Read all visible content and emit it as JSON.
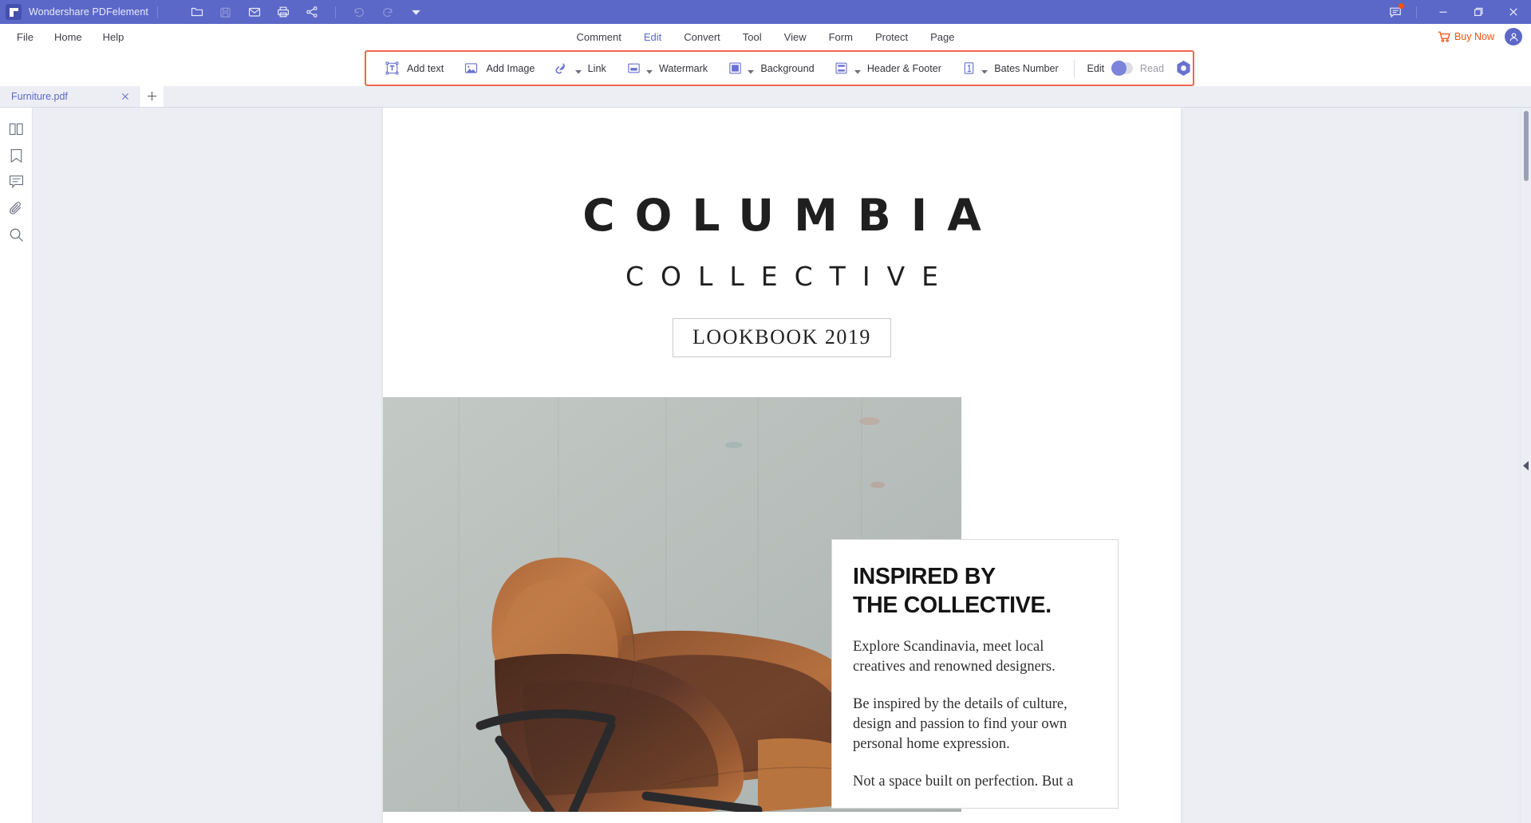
{
  "app": {
    "title": "Wondershare PDFelement",
    "accent": "#5b68c8",
    "highlight_box_color": "#ef6653",
    "buy_color": "#f4500f"
  },
  "titlebar": {
    "quick_actions": [
      {
        "name": "open-folder-icon",
        "label": "Open"
      },
      {
        "name": "save-icon",
        "label": "Save"
      },
      {
        "name": "email-icon",
        "label": "Email"
      },
      {
        "name": "print-icon",
        "label": "Print"
      },
      {
        "name": "share-icon",
        "label": "Share"
      },
      {
        "name": "undo-icon",
        "label": "Undo"
      },
      {
        "name": "redo-icon",
        "label": "Redo"
      },
      {
        "name": "customize-icon",
        "label": "Customize Quick Access Toolbar"
      }
    ],
    "notification_label": "Notifications",
    "window_controls": {
      "minimize": "Minimize",
      "maximize": "Restore",
      "close": "Close"
    }
  },
  "menubar": {
    "left_items": [
      {
        "label": "File",
        "active": false
      },
      {
        "label": "Home",
        "active": false
      },
      {
        "label": "Help",
        "active": false
      }
    ],
    "center_items": [
      {
        "label": "Comment",
        "active": false
      },
      {
        "label": "Edit",
        "active": true
      },
      {
        "label": "Convert",
        "active": false
      },
      {
        "label": "Tool",
        "active": false
      },
      {
        "label": "View",
        "active": false
      },
      {
        "label": "Form",
        "active": false
      },
      {
        "label": "Protect",
        "active": false
      },
      {
        "label": "Page",
        "active": false
      }
    ],
    "buy_now_label": "Buy Now",
    "account_label": "Account"
  },
  "ribbon": {
    "items": [
      {
        "label": "Add text",
        "icon": "add-text-icon",
        "caret": false
      },
      {
        "label": "Add Image",
        "icon": "add-image-icon",
        "caret": false
      },
      {
        "label": "Link",
        "icon": "link-icon",
        "caret": true
      },
      {
        "label": "Watermark",
        "icon": "watermark-icon",
        "caret": true
      },
      {
        "label": "Background",
        "icon": "background-icon",
        "caret": true
      },
      {
        "label": "Header & Footer",
        "icon": "header-footer-icon",
        "caret": true
      },
      {
        "label": "Bates Number",
        "icon": "bates-number-icon",
        "caret": true
      }
    ],
    "mode_toggle": {
      "on_label": "Edit",
      "off_label": "Read",
      "state": "Edit"
    },
    "extra_button": "advanced-mode-icon"
  },
  "tabstrip": {
    "tabs": [
      {
        "name": "Furniture.pdf",
        "active": true
      }
    ],
    "close_label": "Close tab",
    "new_tab_label": "New tab"
  },
  "leftrail": {
    "items": [
      {
        "name": "thumbnails-icon",
        "label": "Thumbnails"
      },
      {
        "name": "bookmark-icon",
        "label": "Bookmarks"
      },
      {
        "name": "comment-icon",
        "label": "Annotations"
      },
      {
        "name": "attachment-icon",
        "label": "Attachments"
      },
      {
        "name": "search-icon",
        "label": "Search"
      }
    ],
    "expand_label": "Expand panel"
  },
  "document": {
    "brand_line1": "COLUMBIA",
    "brand_line2": "COLLECTIVE",
    "badge": "LOOKBOOK 2019",
    "photo_alt": "Tan leather armchair against a pale concrete wall",
    "callout": {
      "heading_line1": "INSPIRED BY",
      "heading_line2": "THE COLLECTIVE.",
      "paragraph1": "Explore Scandinavia, meet local creatives and renowned designers.",
      "paragraph2": "Be inspired by the details of culture, design and passion to find your own personal home expression.",
      "paragraph3": "Not a space built on perfection. But a"
    }
  },
  "viewer": {
    "collapse_right_label": "Collapse right panel",
    "scrollbar_label": "Vertical scrollbar"
  }
}
